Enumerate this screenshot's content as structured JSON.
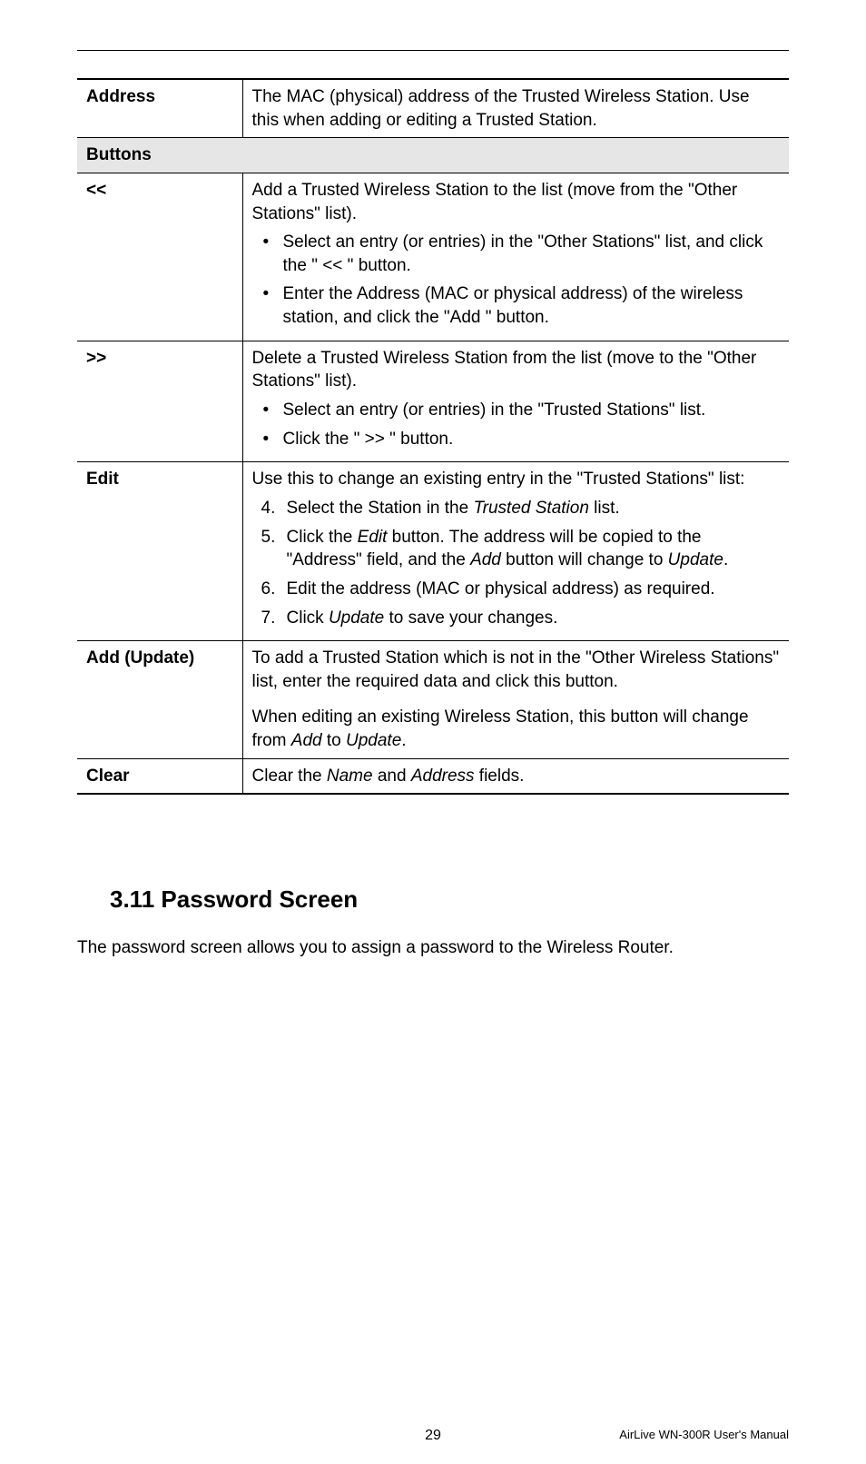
{
  "table": {
    "address": {
      "label": "Address",
      "desc": "The MAC (physical) address of the Trusted Wireless Station. Use this when adding or editing a Trusted Station."
    },
    "buttons_header": "Buttons",
    "lshift": {
      "label": "<<",
      "intro": "Add a Trusted Wireless Station to the list (move from the \"Other Stations\" list).",
      "b1": "Select an entry (or entries) in the \"Other Stations\" list, and click the \" << \" button.",
      "b2": "Enter the Address (MAC or physical address) of the wireless station, and click the \"Add \" button."
    },
    "rshift": {
      "label": ">>",
      "intro": "Delete a Trusted Wireless Station from the list (move to the \"Other Stations\" list).",
      "b1": "Select an entry (or entries) in the \"Trusted Stations\" list.",
      "b2": "Click the \" >> \" button."
    },
    "edit": {
      "label": "Edit",
      "intro": "Use this to change an existing entry in the \"Trusted Stations\" list:",
      "n4_a": "Select the Station in the ",
      "n4_b": "Trusted Station",
      "n4_c": " list.",
      "n5_a": "Click the ",
      "n5_b": "Edit",
      "n5_c": " button. The address will be copied to the \"Address\" field, and the ",
      "n5_d": "Add",
      "n5_e": " button will change to ",
      "n5_f": "Update",
      "n5_g": ".",
      "n6": "Edit the address (MAC or physical address) as required.",
      "n7_a": "Click ",
      "n7_b": "Update",
      "n7_c": " to save your changes."
    },
    "add_update": {
      "label": "Add (Update)",
      "p1": "To add a Trusted Station which is not in the \"Other Wireless Stations\" list, enter the required data and click this button.",
      "p2_a": "When editing an existing Wireless Station, this button will change from ",
      "p2_b": "Add",
      "p2_c": " to ",
      "p2_d": "Update",
      "p2_e": "."
    },
    "clear": {
      "label": "Clear",
      "desc_a": "Clear the ",
      "desc_b": "Name",
      "desc_c": " and ",
      "desc_d": "Address",
      "desc_e": " fields."
    }
  },
  "section": {
    "title": "3.11 Password Screen",
    "body": "The password screen allows you to assign a password to the Wireless Router."
  },
  "footer": {
    "page": "29",
    "right": "AirLive WN-300R User's Manual"
  }
}
